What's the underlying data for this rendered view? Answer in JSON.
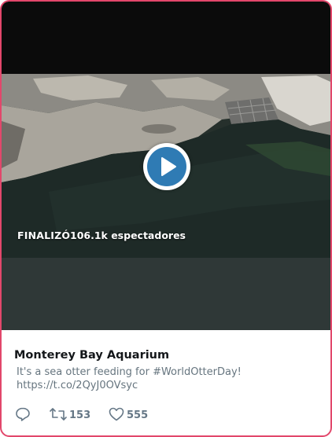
{
  "video": {
    "status": "FINALIZÓ",
    "viewers": "106.1k espectadores"
  },
  "tweet": {
    "author": "Monterey Bay Aquarium",
    "text_line1": "It's a sea otter feeding for #WorldOtterDay!",
    "text_line2": "https://t.co/2QyJ0OVsyc"
  },
  "actions": {
    "retweet_count": "153",
    "like_count": "555"
  },
  "colors": {
    "card_border": "#e2476b",
    "play_button": "#2f7bb4",
    "action_gray": "#657786"
  },
  "icons": [
    "play-icon",
    "reply-icon",
    "retweet-icon",
    "heart-icon"
  ]
}
